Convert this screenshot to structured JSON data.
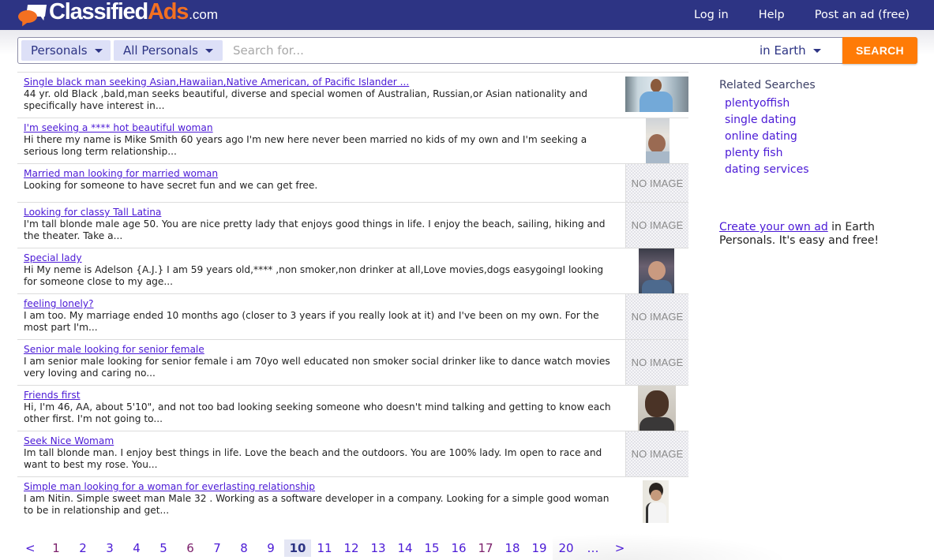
{
  "brand": {
    "name_part1": "Classified",
    "name_part2": "Ads",
    "name_suffix": ".com",
    "accent_color": "#f37021",
    "header_color": "#2d3484"
  },
  "topnav": {
    "login": "Log in",
    "help": "Help",
    "post_ad": "Post an ad (free)"
  },
  "search": {
    "category": "Personals",
    "subcategory": "All Personals",
    "placeholder": "Search for...",
    "value": "",
    "location": "in Earth",
    "button": "SEARCH",
    "button_color": "#ff7b06"
  },
  "listings": [
    {
      "title": "Single black man seeking Asian,Hawaiian,Native American, of Pacific Islander ...",
      "desc": "44 yr. old Black ,bald,man seeks beautiful, diverse and special women of Australian, Russian,or Asian nationality and specifically have interest in...",
      "image": "photo"
    },
    {
      "title": "I'm seeking a **** hot beautiful woman",
      "desc": "Hi there my name is Mike Smith 60 years ago I'm new here never been married no kids of my own and I'm seeking a serious long term relationship...",
      "image": "photo"
    },
    {
      "title": "Married man looking for married woman",
      "desc": "Looking for someone to have secret fun and we can get free.",
      "image": "none"
    },
    {
      "title": "Looking for classy Tall Latina",
      "desc": "I'm tall blonde male age 50. You are nice pretty lady that enjoys good things in life. I enjoy the beach, sailing, hiking and the theater. Take a...",
      "image": "none"
    },
    {
      "title": "Special lady",
      "desc": "Hi My neme is Adelson {A.J.} I am 59 years old,**** ,non smoker,non drinker at all,Love movies,dogs easygoingI looking for someone close to my age...",
      "image": "photo"
    },
    {
      "title": "feeling lonely?",
      "desc": "I am too. My marriage ended 10 months ago (closer to 3 years if you really look at it) and I've been on my own. For the most part I'm...",
      "image": "none"
    },
    {
      "title": "Senior male looking for senior female",
      "desc": "I am senior male looking for senior female i am 70yo well educated non smoker social drinker like to dance watch movies very loving and caring no...",
      "image": "none"
    },
    {
      "title": "Friends first",
      "desc": "Hi, I'm 46, AA, about 5'10\", and not too bad looking seeking someone who doesn't mind talking and getting to know each other first. I'm not going to...",
      "image": "photo"
    },
    {
      "title": "Seek Nice Womam",
      "desc": "Im tall blonde man. I enjoy best things in life. Love the beach and the outdoors. You are 100% lady. Im open to race and want to best my rose. You...",
      "image": "none"
    },
    {
      "title": "Simple man looking for a woman for everlasting relationship",
      "desc": "I am Nitin. Simple sweet man Male 32 . Working as a software developer in a company. Looking for a simple good woman to be in relationship and get...",
      "image": "photo"
    }
  ],
  "no_image_label": "NO IMAGE",
  "pagination": {
    "prev": "<",
    "next": ">",
    "ellipsis": "…",
    "current": "10",
    "pages": [
      "1",
      "2",
      "3",
      "4",
      "5",
      "6",
      "7",
      "8",
      "9",
      "10",
      "11",
      "12",
      "13",
      "14",
      "15",
      "16",
      "17",
      "18",
      "19",
      "20"
    ],
    "visited": [
      "1",
      "6",
      "17"
    ]
  },
  "sidebar": {
    "related_title": "Related Searches",
    "related": [
      "plentyoffish",
      "single dating",
      "online dating",
      "plenty fish",
      "dating services"
    ],
    "create_link": "Create your own ad",
    "create_text_1": " in Earth",
    "create_text_2": "Personals. It's easy and free!"
  }
}
